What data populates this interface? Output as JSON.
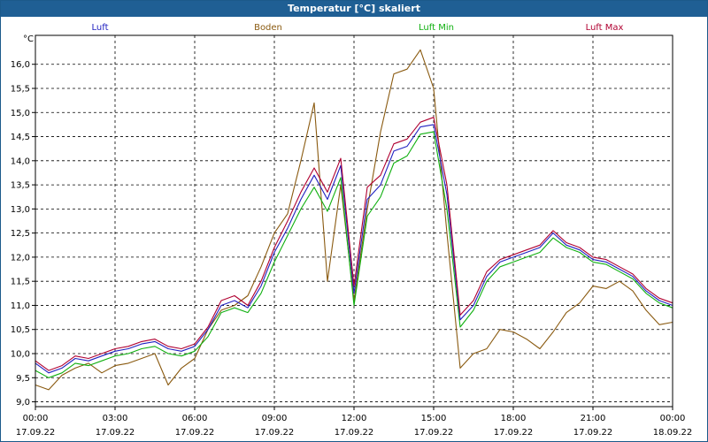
{
  "window": {
    "title": "Temperatur [°C] skaliert"
  },
  "colors": {
    "title_bar": "#1f5f94",
    "luft": "#2020c0",
    "boden": "#8a5a10",
    "luft_min": "#10b010",
    "luft_max": "#b00030",
    "grid": "#000000"
  },
  "chart_data": {
    "type": "line",
    "title": "Temperatur [°C] skaliert",
    "ylabel": "°C",
    "ylim": [
      8.9,
      16.6
    ],
    "xlim": [
      "2022-09-17T00:00",
      "2022-09-18T00:00"
    ],
    "grid": true,
    "legend_placement": "top",
    "y_ticks": [
      "9,0",
      "9,5",
      "10,0",
      "10,5",
      "11,0",
      "11,5",
      "12,0",
      "12,5",
      "13,0",
      "13,5",
      "14,0",
      "14,5",
      "15,0",
      "15,5",
      "16,0"
    ],
    "x_ticks": [
      {
        "time": "00:00",
        "date": "17.09.22"
      },
      {
        "time": "03:00",
        "date": "17.09.22"
      },
      {
        "time": "06:00",
        "date": "17.09.22"
      },
      {
        "time": "09:00",
        "date": "17.09.22"
      },
      {
        "time": "12:00",
        "date": "17.09.22"
      },
      {
        "time": "15:00",
        "date": "17.09.22"
      },
      {
        "time": "18:00",
        "date": "17.09.22"
      },
      {
        "time": "21:00",
        "date": "17.09.22"
      },
      {
        "time": "00:00",
        "date": "18.09.22"
      }
    ],
    "x": [
      "00:00",
      "00:30",
      "01:00",
      "01:30",
      "02:00",
      "02:30",
      "03:00",
      "03:30",
      "04:00",
      "04:30",
      "05:00",
      "05:30",
      "06:00",
      "06:30",
      "07:00",
      "07:30",
      "08:00",
      "08:30",
      "09:00",
      "09:30",
      "10:00",
      "10:30",
      "11:00",
      "11:30",
      "12:00",
      "12:30",
      "13:00",
      "13:30",
      "14:00",
      "14:30",
      "15:00",
      "15:30",
      "16:00",
      "16:30",
      "17:00",
      "17:30",
      "18:00",
      "18:30",
      "19:00",
      "19:30",
      "20:00",
      "20:30",
      "21:00",
      "21:30",
      "22:00",
      "22:30",
      "23:00",
      "23:30",
      "24:00"
    ],
    "series": [
      {
        "name": "Luft",
        "values": [
          9.8,
          9.6,
          9.7,
          9.9,
          9.85,
          9.95,
          10.05,
          10.1,
          10.2,
          10.25,
          10.1,
          10.05,
          10.15,
          10.5,
          11.0,
          11.1,
          10.95,
          11.4,
          12.1,
          12.6,
          13.2,
          13.7,
          13.2,
          13.9,
          11.25,
          13.2,
          13.5,
          14.2,
          14.3,
          14.7,
          14.75,
          13.3,
          10.7,
          11.0,
          11.6,
          11.9,
          12.0,
          12.1,
          12.2,
          12.5,
          12.25,
          12.15,
          11.95,
          11.9,
          11.75,
          11.6,
          11.3,
          11.1,
          11.0
        ]
      },
      {
        "name": "Boden",
        "values": [
          9.35,
          9.25,
          9.55,
          9.7,
          9.8,
          9.6,
          9.75,
          9.8,
          9.9,
          10.0,
          9.35,
          9.7,
          9.9,
          10.5,
          10.9,
          11.0,
          11.2,
          11.8,
          12.5,
          12.9,
          14.0,
          15.2,
          11.5,
          13.5,
          11.1,
          13.0,
          14.6,
          15.8,
          15.9,
          16.3,
          15.5,
          12.5,
          9.7,
          10.0,
          10.1,
          10.5,
          10.45,
          10.3,
          10.1,
          10.45,
          10.85,
          11.05,
          11.4,
          11.35,
          11.5,
          11.3,
          10.9,
          10.6,
          10.65
        ]
      },
      {
        "name": "Luft Min",
        "values": [
          9.65,
          9.5,
          9.6,
          9.8,
          9.75,
          9.85,
          9.95,
          10.0,
          10.1,
          10.15,
          10.0,
          9.95,
          10.05,
          10.35,
          10.85,
          10.95,
          10.85,
          11.25,
          11.9,
          12.45,
          13.0,
          13.45,
          12.95,
          13.65,
          11.0,
          12.85,
          13.25,
          13.95,
          14.1,
          14.55,
          14.6,
          13.0,
          10.55,
          10.9,
          11.5,
          11.8,
          11.9,
          12.0,
          12.1,
          12.4,
          12.2,
          12.1,
          11.9,
          11.85,
          11.7,
          11.55,
          11.25,
          11.05,
          10.95
        ]
      },
      {
        "name": "Luft Max",
        "values": [
          9.85,
          9.65,
          9.75,
          9.95,
          9.9,
          10.0,
          10.1,
          10.15,
          10.25,
          10.3,
          10.15,
          10.1,
          10.2,
          10.55,
          11.1,
          11.2,
          11.0,
          11.5,
          12.2,
          12.75,
          13.35,
          13.85,
          13.35,
          14.05,
          11.4,
          13.45,
          13.7,
          14.35,
          14.45,
          14.8,
          14.9,
          13.5,
          10.8,
          11.1,
          11.7,
          11.95,
          12.05,
          12.15,
          12.25,
          12.55,
          12.3,
          12.2,
          12.0,
          11.95,
          11.8,
          11.65,
          11.35,
          11.15,
          11.05
        ]
      }
    ]
  }
}
